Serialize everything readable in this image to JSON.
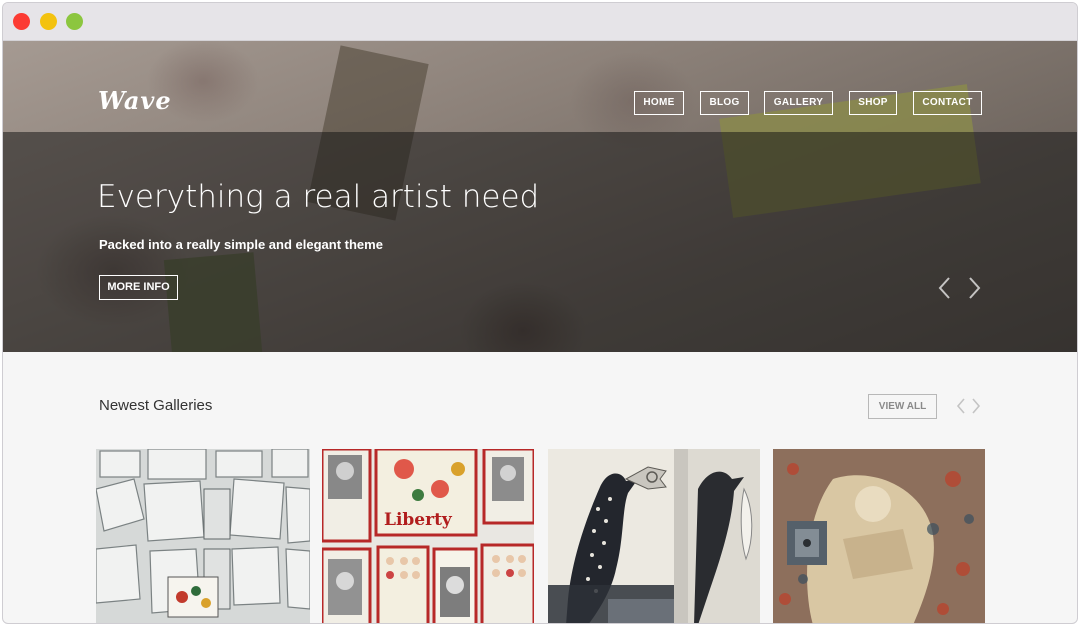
{
  "window": {
    "controls": [
      "close",
      "minimize",
      "maximize"
    ]
  },
  "header": {
    "logo": "Wave",
    "nav": [
      {
        "label": "HOME"
      },
      {
        "label": "BLOG"
      },
      {
        "label": "GALLERY"
      },
      {
        "label": "SHOP"
      },
      {
        "label": "CONTACT"
      }
    ]
  },
  "hero": {
    "title": "Everything a real artist need",
    "subtitle": "Packed into a really simple and elegant theme",
    "button_label": "MORE INFO",
    "prev_icon": "chevron-left-icon",
    "next_icon": "chevron-right-icon"
  },
  "galleries": {
    "title": "Newest Galleries",
    "view_all_label": "VIEW ALL",
    "items": [
      {
        "description_icon": "gallery-thumbnail"
      },
      {
        "description_icon": "gallery-thumbnail"
      },
      {
        "description_icon": "gallery-thumbnail"
      },
      {
        "description_icon": "gallery-thumbnail"
      }
    ]
  },
  "colors": {
    "accent": "#ffffff",
    "hero_overlay": "#333333",
    "section_bg": "#f6f6f6",
    "text_dark": "#333333"
  }
}
